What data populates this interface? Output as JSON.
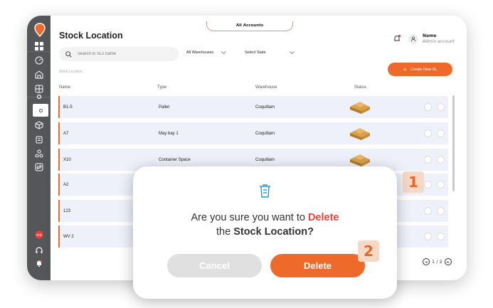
{
  "header": {
    "title": "Stock Location",
    "accounts_tab": "All Accounts",
    "user": {
      "name": "Name",
      "role": "Admin account"
    }
  },
  "filters": {
    "search_placeholder": "Search in SLs name",
    "warehouse_select": "All Warehouses",
    "state_select": "Select State"
  },
  "breadcrumb": "Stock Location",
  "create_button": {
    "icon": "+",
    "label": "Create New SL"
  },
  "table": {
    "columns": [
      "Name",
      "Type",
      "Warehouse",
      "Status"
    ],
    "rows": [
      {
        "name": "B1-5",
        "type": "Pallet",
        "warehouse": "Coquitlam"
      },
      {
        "name": "A7",
        "type": "May bay 1",
        "warehouse": "Coquitlam"
      },
      {
        "name": "X10",
        "type": "Container Space",
        "warehouse": "Coquitlam"
      },
      {
        "name": "A2",
        "type": "",
        "warehouse": ""
      },
      {
        "name": "123",
        "type": "",
        "warehouse": ""
      },
      {
        "name": "WV 2",
        "type": "",
        "warehouse": ""
      }
    ]
  },
  "pagination": {
    "text": "1 / 2"
  },
  "modal": {
    "line1_prefix": "Are you sure you want to ",
    "line1_highlight": "Delete",
    "line2_prefix": "the ",
    "line2_bold": "Stock Location?",
    "cancel_label": "Cancel",
    "delete_label": "Delete"
  },
  "steps": [
    "1",
    "2"
  ],
  "colors": {
    "accent": "#ee6a2b",
    "danger": "#e8433b",
    "sidebar": "#555659",
    "row_bg": "#eef0fa"
  }
}
